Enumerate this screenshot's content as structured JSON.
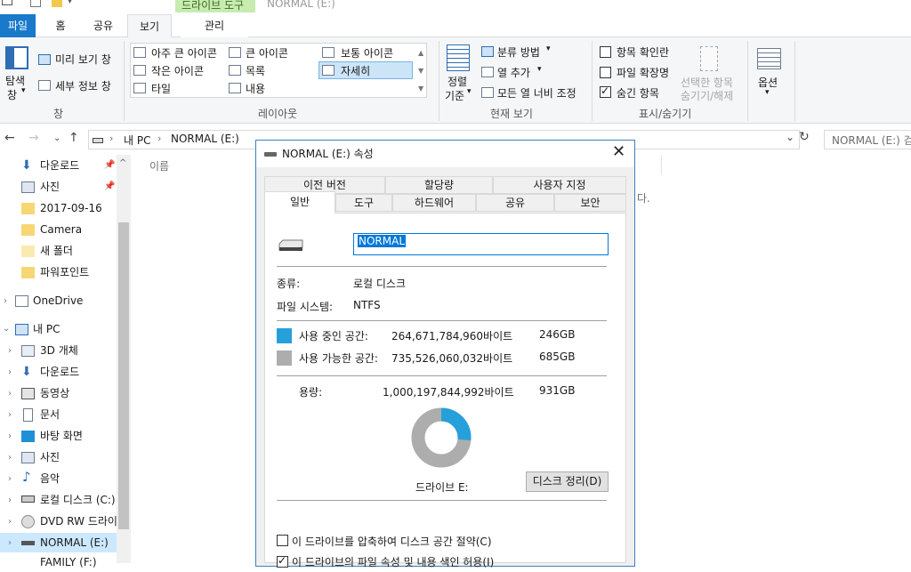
{
  "window": {
    "title": "NORMAL (E:)",
    "contextual_tab_group": "드라이브 도구"
  },
  "tabs": {
    "file": "파일",
    "home": "홈",
    "share": "공유",
    "view": "보기",
    "manage": "관리"
  },
  "ribbon": {
    "panes": {
      "nav_pane": "탐색 창",
      "nav_pane_line1": "탐색",
      "nav_pane_line2": "창",
      "preview": "미리 보기 창",
      "details": "세부 정보 창",
      "group_label": "창"
    },
    "layout": {
      "items": [
        "아주 큰 아이콘",
        "큰 아이콘",
        "보통 아이콘",
        "작은 아이콘",
        "목록",
        "자세히",
        "타일",
        "내용"
      ],
      "selected": "자세히",
      "group_label": "레이아웃"
    },
    "current_view": {
      "sort_line1": "정렬",
      "sort_line2": "기준",
      "group_by": "분류 방법",
      "add_columns": "열 추가",
      "size_all_columns": "모든 열 너비 조정",
      "group_label": "현재 보기"
    },
    "show_hide": {
      "item_checkboxes": "항목 확인란",
      "item_checkboxes_checked": false,
      "file_extensions": "파일 확장명",
      "file_extensions_checked": false,
      "hidden_items": "숨긴 항목",
      "hidden_items_checked": true,
      "hide_selected_line1": "선택한 항목",
      "hide_selected_line2": "숨기기/해제",
      "group_label": "표시/숨기기"
    },
    "options": "옵션"
  },
  "address": {
    "path_root": "내 PC",
    "path_current": "NORMAL (E:)",
    "search_placeholder": "NORMAL (E:) 검"
  },
  "sidebar": {
    "quick_access": [
      "다운로드",
      "사진",
      "2017-09-16",
      "Camera",
      "새 폴더",
      "파워포인트"
    ],
    "onedrive": "OneDrive",
    "this_pc": "내 PC",
    "pc_items": [
      "3D 개체",
      "다운로드",
      "동영상",
      "문서",
      "바탕 화면",
      "사진",
      "음악",
      "로컬 디스크 (C:)",
      "DVD RW 드라이",
      "NORMAL (E:)",
      "FAMILY (F:)"
    ]
  },
  "content": {
    "column_name": "이름",
    "empty_text_tail": "다."
  },
  "dialog": {
    "title": "NORMAL (E:) 속성",
    "tabs_row1": [
      "이전 버전",
      "할당량",
      "사용자 지정"
    ],
    "tabs_row2": [
      "일반",
      "도구",
      "하드웨어",
      "공유",
      "보안"
    ],
    "active_tab": "일반",
    "name_value": "NORMAL",
    "type_label": "종류:",
    "type_value": "로컬 디스크",
    "fs_label": "파일 시스템:",
    "fs_value": "NTFS",
    "used_label": "사용 중인 공간:",
    "used_bytes": "264,671,784,960바이트",
    "used_gb": "246GB",
    "free_label": "사용 가능한 공간:",
    "free_bytes": "735,526,060,032바이트",
    "free_gb": "685GB",
    "capacity_label": "용량:",
    "capacity_bytes": "1,000,197,844,992바이트",
    "capacity_gb": "931GB",
    "used_fraction": 0.2646,
    "drive_label": "드라이브 E:",
    "cleanup_button": "디스크 정리(D)",
    "compress_label": "이 드라이브를 압축하여 디스크 공간 절약(C)",
    "compress_checked": false,
    "index_label": "이 드라이브의 파일 속성 및 내용 색인 허용(I)",
    "index_checked": true
  },
  "colors": {
    "accent": "#1979ca",
    "used": "#26a0da",
    "free": "#adadad",
    "selection": "#0078d7"
  }
}
